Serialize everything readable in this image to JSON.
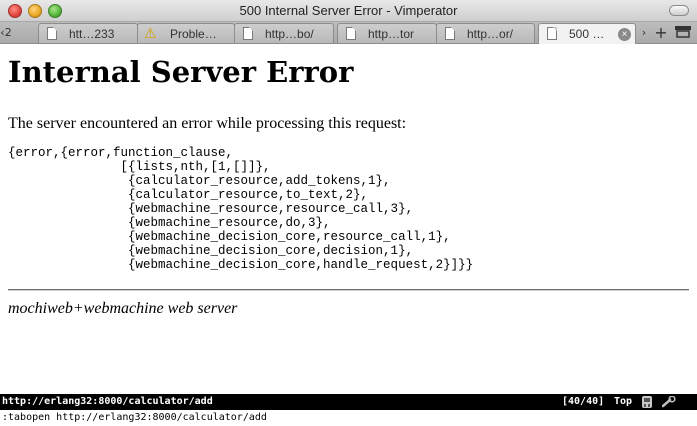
{
  "window": {
    "title": "500 Internal Server Error - Vimperator"
  },
  "tabbar": {
    "scroll_left_label": "2",
    "tabs": [
      {
        "label": "htt…233",
        "icon": "document-icon",
        "active": false
      },
      {
        "label": "Proble…",
        "icon": "warning-icon",
        "active": false
      },
      {
        "label": "http…bo/",
        "icon": "document-icon",
        "active": false
      },
      {
        "label": "http…tor",
        "icon": "document-icon",
        "active": false
      },
      {
        "label": "http…or/",
        "icon": "document-icon",
        "active": false
      },
      {
        "label": "500 …",
        "icon": "document-icon",
        "active": true
      }
    ],
    "scroll_right_glyph": "›",
    "new_tab_glyph": "+"
  },
  "page": {
    "heading": "Internal Server Error",
    "intro": "The server encountered an error while processing this request:",
    "error_trace": "{error,{error,function_clause,\n               [{lists,nth,[1,[]]},\n                {calculator_resource,add_tokens,1},\n                {calculator_resource,to_text,2},\n                {webmachine_resource,resource_call,3},\n                {webmachine_resource,do,3},\n                {webmachine_decision_core,resource_call,1},\n                {webmachine_decision_core,decision,1},\n                {webmachine_decision_core,handle_request,2}]}}",
    "server_signature": "mochiweb+webmachine web server"
  },
  "statusline": {
    "url": "http://erlang32:8000/calculator/add",
    "tab_count": "[40/40]",
    "scroll_position": "Top",
    "icons": [
      "addon-icon",
      "wrench-icon"
    ]
  },
  "commandline": {
    "text": ":tabopen http://erlang32:8000/calculator/add"
  },
  "colors": {
    "statusline_bg": "#000000",
    "statusline_fg": "#ffffff",
    "close_button": "#e0443e",
    "minimize_button": "#e8a726",
    "zoom_button": "#55b43a"
  }
}
